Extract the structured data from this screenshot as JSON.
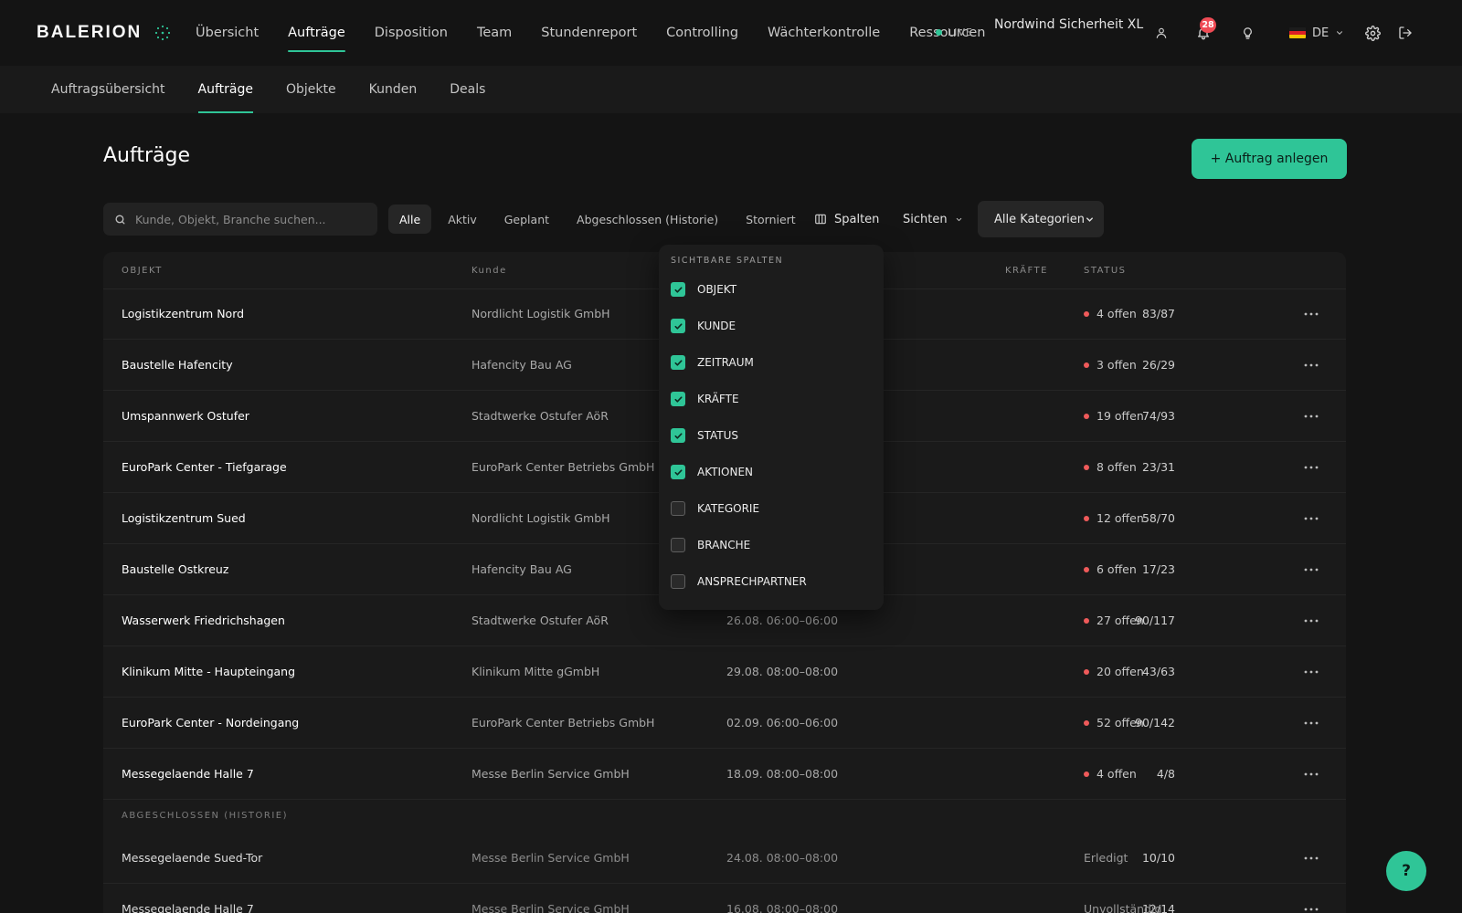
{
  "app": {
    "logo": "BALERION"
  },
  "header": {
    "nav": [
      "Übersicht",
      "Aufträge",
      "Disposition",
      "Team",
      "Stundenreport",
      "Controlling",
      "Wächterkontrolle",
      "Ressourcen"
    ],
    "active_nav": "Aufträge",
    "live_label": "LIVE",
    "org_name": "Nordwind Sicherheit XL",
    "notification_count": "28",
    "language": "DE"
  },
  "subnav": {
    "items": [
      "Auftragsübersicht",
      "Aufträge",
      "Objekte",
      "Kunden",
      "Deals"
    ],
    "active": "Aufträge"
  },
  "page": {
    "title": "Aufträge",
    "create_button": "+ Auftrag anlegen"
  },
  "toolbar": {
    "search_placeholder": "Kunde, Objekt, Branche suchen...",
    "filters": [
      "Alle",
      "Aktiv",
      "Geplant",
      "Abgeschlossen (Historie)",
      "Storniert"
    ],
    "active_filter": "Alle",
    "columns_button": "Spalten",
    "views_button": "Sichten",
    "category_select": "Alle Kategorien"
  },
  "table": {
    "headers": {
      "objekt": "OBJEKT",
      "kunde": "Kunde",
      "kraefte": "KRÄFTE",
      "status": "STATUS"
    },
    "rows": [
      {
        "objekt": "Logistikzentrum Nord",
        "kunde": "Nordlicht Logistik GmbH",
        "zeitraum": "",
        "kraefte": "83/87",
        "status": "4 offen"
      },
      {
        "objekt": "Baustelle Hafencity",
        "kunde": "Hafencity Bau AG",
        "zeitraum": "",
        "kraefte": "26/29",
        "status": "3 offen"
      },
      {
        "objekt": "Umspannwerk Ostufer",
        "kunde": "Stadtwerke Ostufer AöR",
        "zeitraum": "",
        "kraefte": "74/93",
        "status": "19 offen"
      },
      {
        "objekt": "EuroPark Center - Tiefgarage",
        "kunde": "EuroPark Center Betriebs GmbH",
        "zeitraum": "",
        "kraefte": "23/31",
        "status": "8 offen"
      },
      {
        "objekt": "Logistikzentrum Sued",
        "kunde": "Nordlicht Logistik GmbH",
        "zeitraum": "",
        "kraefte": "58/70",
        "status": "12 offen"
      },
      {
        "objekt": "Baustelle Ostkreuz",
        "kunde": "Hafencity Bau AG",
        "zeitraum": "",
        "kraefte": "17/23",
        "status": "6 offen"
      },
      {
        "objekt": "Wasserwerk Friedrichshagen",
        "kunde": "Stadtwerke Ostufer AöR",
        "zeitraum": "26.08. 06:00–06:00",
        "kraefte": "90/117",
        "status": "27 offen"
      },
      {
        "objekt": "Klinikum Mitte - Haupteingang",
        "kunde": "Klinikum Mitte gGmbH",
        "zeitraum": "29.08. 08:00–08:00",
        "kraefte": "43/63",
        "status": "20 offen"
      },
      {
        "objekt": "EuroPark Center - Nordeingang",
        "kunde": "EuroPark Center Betriebs GmbH",
        "zeitraum": "02.09. 06:00–06:00",
        "kraefte": "90/142",
        "status": "52 offen"
      },
      {
        "objekt": "Messegelaende Halle 7",
        "kunde": "Messe Berlin Service GmbH",
        "zeitraum": "18.09. 08:00–08:00",
        "kraefte": "4/8",
        "status": "4 offen"
      }
    ],
    "history_label": "ABGESCHLOSSEN (HISTORIE)",
    "history_rows": [
      {
        "objekt": "Messegelaende Sued-Tor",
        "kunde": "Messe Berlin Service GmbH",
        "zeitraum": "24.08. 08:00–08:00",
        "kraefte": "10/10",
        "status": "Erledigt"
      },
      {
        "objekt": "Messegelaende Halle 7",
        "kunde": "Messe Berlin Service GmbH",
        "zeitraum": "16.08. 08:00–08:00",
        "kraefte": "12/14",
        "status": "Unvollständig"
      }
    ]
  },
  "columns_menu": {
    "title": "SICHTBARE SPALTEN",
    "options": [
      {
        "label": "OBJEKT",
        "checked": true
      },
      {
        "label": "KUNDE",
        "checked": true
      },
      {
        "label": "ZEITRAUM",
        "checked": true
      },
      {
        "label": "KRÄFTE",
        "checked": true
      },
      {
        "label": "STATUS",
        "checked": true
      },
      {
        "label": "AKTIONEN",
        "checked": true
      },
      {
        "label": "KATEGORIE",
        "checked": false
      },
      {
        "label": "BRANCHE",
        "checked": false
      },
      {
        "label": "ANSPRECHPARTNER",
        "checked": false
      }
    ]
  },
  "help": {
    "label": "?"
  },
  "icons": {
    "search": "search-icon",
    "user": "user-icon",
    "bell": "bell-icon",
    "lightbulb": "lightbulb-icon",
    "settings": "gear-icon",
    "logout": "logout-icon",
    "columns": "columns-icon",
    "more": "more-horizontal-icon"
  },
  "colors": {
    "accent": "#2fc597",
    "badge": "#ef4b55",
    "status_open": "#ef5a5a",
    "background": "#141414"
  }
}
